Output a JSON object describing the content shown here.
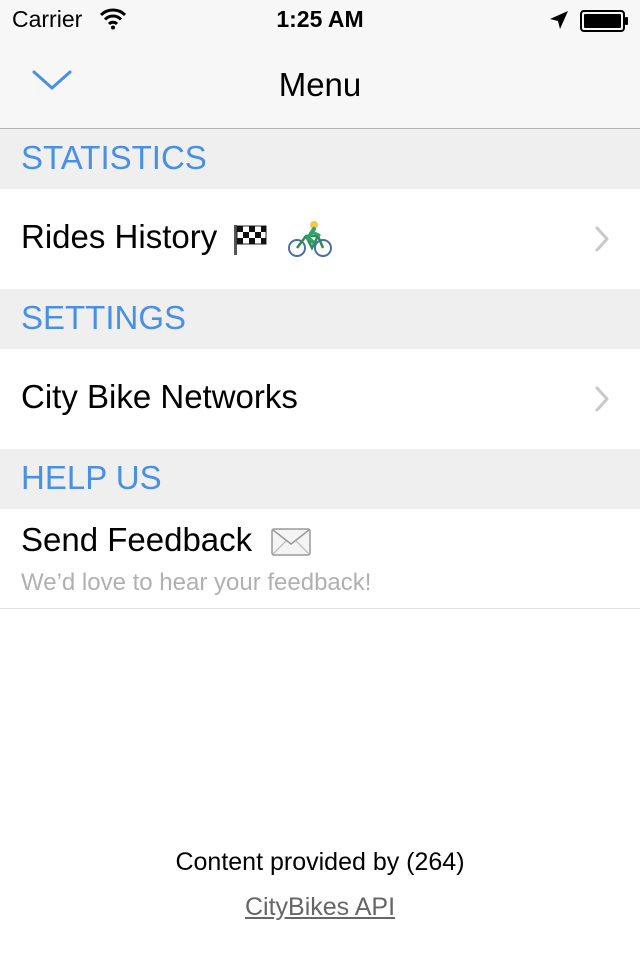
{
  "status_bar": {
    "carrier": "Carrier",
    "time": "1:25 AM",
    "icons": [
      "wifi-icon",
      "location-arrow-icon",
      "battery-icon"
    ]
  },
  "nav": {
    "title": "Menu",
    "back_icon": "chevron-down-icon"
  },
  "sections": [
    {
      "header": "STATISTICS",
      "rows": [
        {
          "label": "Rides History",
          "emoji": [
            "checkered-flag-icon",
            "bicyclist-icon"
          ],
          "accessory": "chevron-right-icon"
        }
      ]
    },
    {
      "header": "SETTINGS",
      "rows": [
        {
          "label": "City Bike Networks",
          "accessory": "chevron-right-icon"
        }
      ]
    },
    {
      "header": "HELP US",
      "rows": [
        {
          "label": "Send Feedback",
          "emoji": [
            "envelope-icon"
          ],
          "subtitle": "We’d love to hear your feedback!"
        }
      ]
    }
  ],
  "footer": {
    "text": "Content provided by (264)",
    "link": "CityBikes API"
  },
  "colors": {
    "accent": "#4a90e2",
    "section_bg": "#efefef",
    "bar_bg": "#f7f7f7",
    "subtitle": "#b0b0b0"
  }
}
